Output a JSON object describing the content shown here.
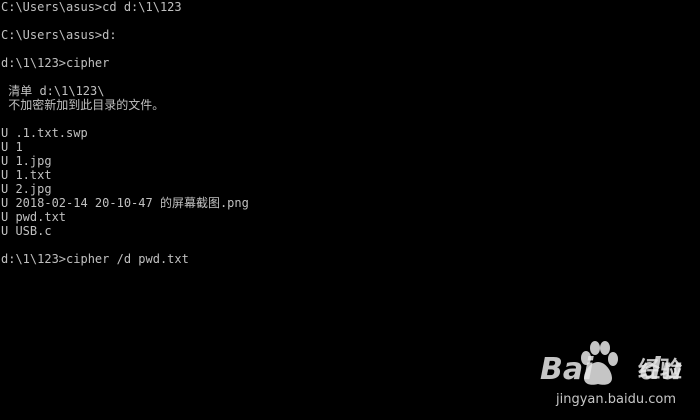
{
  "terminal": {
    "lines": [
      "C:\\Users\\asus>cd d:\\1\\123",
      "",
      "C:\\Users\\asus>d:",
      "",
      "d:\\1\\123>cipher",
      "",
      " 清单 d:\\1\\123\\",
      " 不加密新加到此目录的文件。",
      "",
      "U .1.txt.swp",
      "U 1",
      "U 1.jpg",
      "U 1.txt",
      "U 2.jpg",
      "U 2018-02-14 20-10-47 的屏幕截图.png",
      "U pwd.txt",
      "U USB.c",
      "",
      "d:\\1\\123>cipher /d pwd.txt"
    ],
    "text_color": "#c0c0c0",
    "background_color": "#000000"
  },
  "watermark": {
    "brand": "Bai",
    "brand_suffix": "du",
    "jingyan": "经验",
    "url": "jingyan.baidu.com",
    "icon": "baidu-paw-icon"
  }
}
